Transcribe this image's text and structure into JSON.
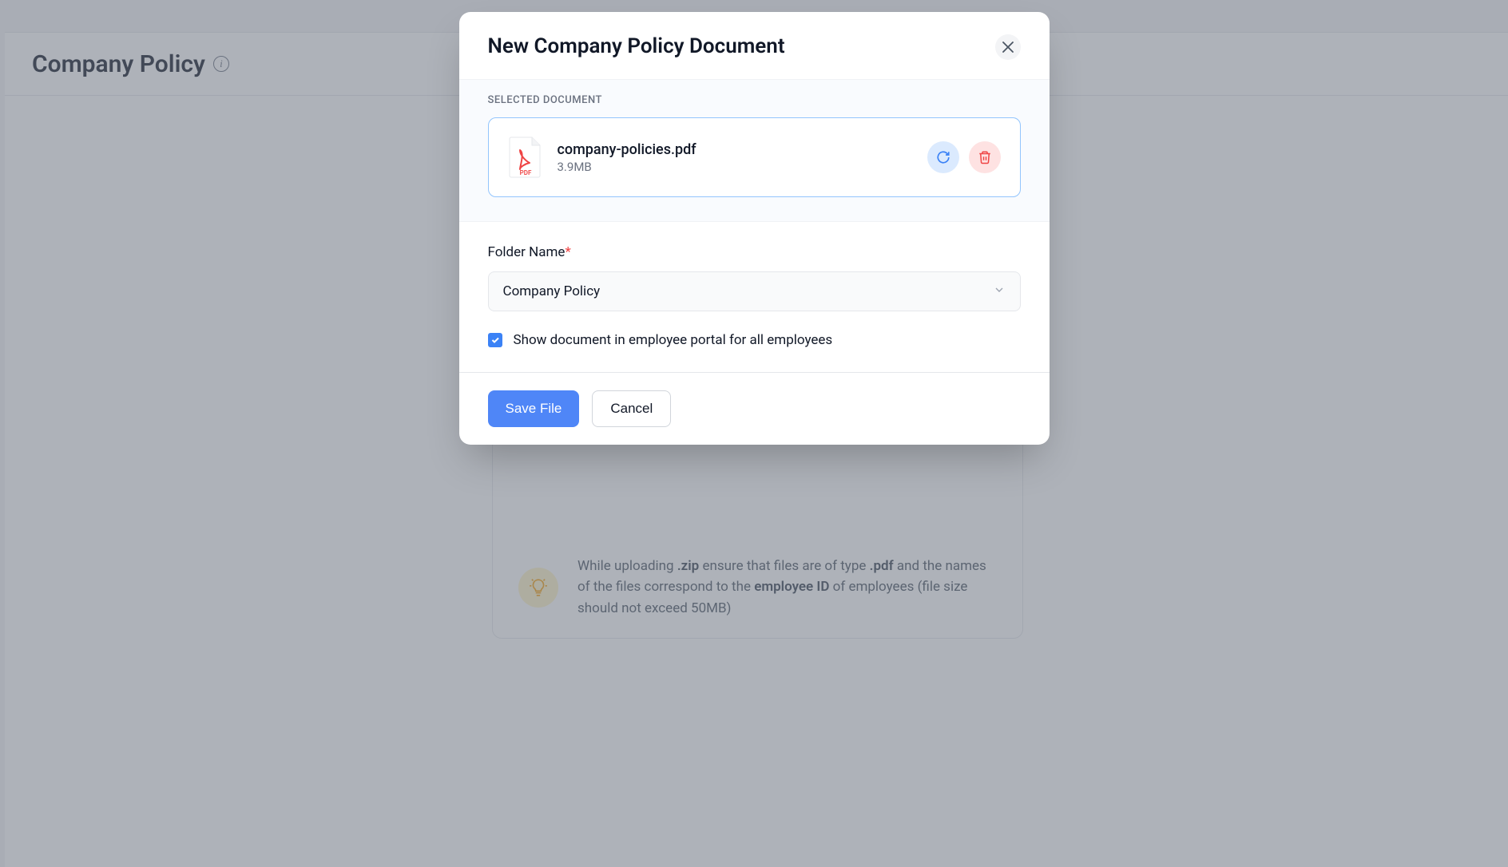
{
  "background": {
    "page_title": "Company Policy",
    "hint_text_parts": {
      "prefix": "While uploading ",
      "zip": ".zip",
      "mid1": " ensure that files are of type ",
      "pdf": ".pdf",
      "mid2": " and the names of the files correspond to the ",
      "empid": "employee ID",
      "suffix": " of employees (file size should not exceed 50MB)"
    }
  },
  "modal": {
    "title": "New Company Policy Document",
    "selected_label": "SELECTED DOCUMENT",
    "file": {
      "name": "company-policies.pdf",
      "size": "3.9MB",
      "type_label": "PDF"
    },
    "folder": {
      "label": "Folder Name",
      "value": "Company Policy"
    },
    "checkbox": {
      "label": "Show document in employee portal for all employees",
      "checked": true
    },
    "buttons": {
      "save": "Save File",
      "cancel": "Cancel"
    }
  }
}
